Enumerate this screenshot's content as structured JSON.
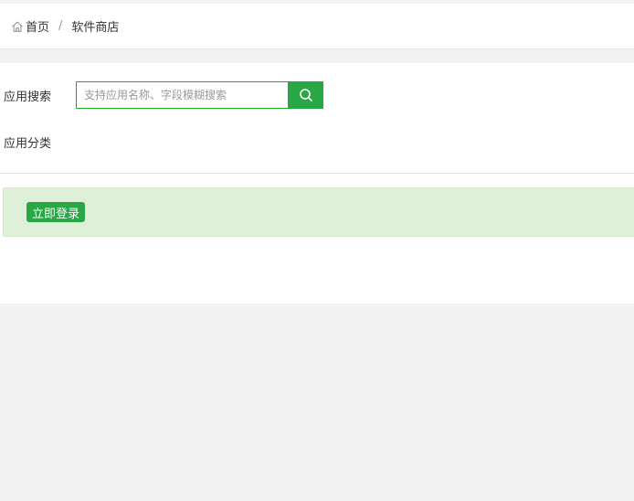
{
  "breadcrumb": {
    "home_label": "首页",
    "separator": "/",
    "current_label": "软件商店"
  },
  "search": {
    "label": "应用搜索",
    "placeholder": "支持应用名称、字段模糊搜索",
    "value": ""
  },
  "category": {
    "label": "应用分类"
  },
  "alert": {
    "login_label": "立即登录"
  },
  "colors": {
    "accent": "#28a745",
    "alert_bg": "#dff0d8"
  }
}
